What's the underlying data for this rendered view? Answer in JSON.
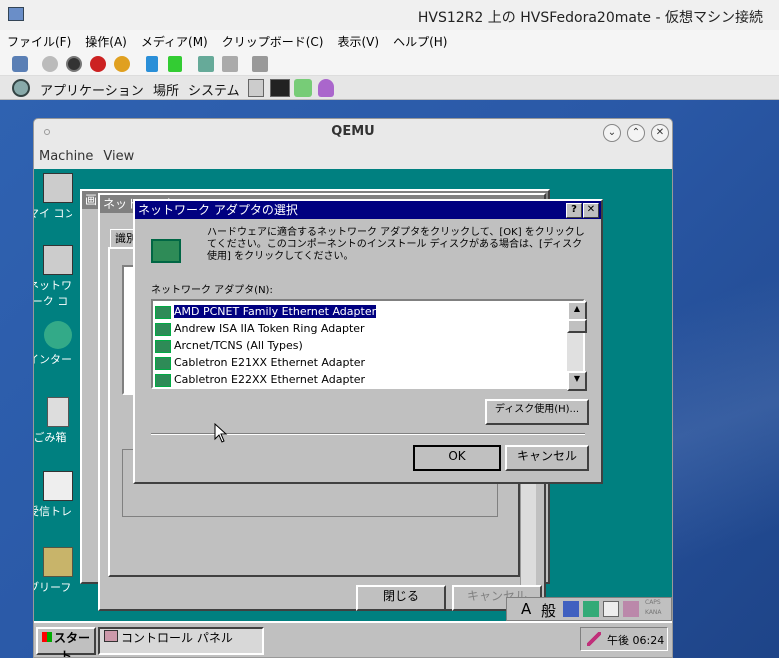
{
  "host": {
    "title": "HVS12R2 上の HVSFedora20mate - 仮想マシン接続",
    "menu": [
      "ファイル(F)",
      "操作(A)",
      "メディア(M)",
      "クリップボード(C)",
      "表示(V)",
      "ヘルプ(H)"
    ]
  },
  "gnome": {
    "menu": [
      "アプリケーション",
      "場所",
      "システム"
    ]
  },
  "qemu": {
    "title": "QEMU",
    "menu": [
      "Machine",
      "View"
    ],
    "buttons": [
      "⌄",
      "⌃",
      "✕"
    ]
  },
  "desktop_icons": [
    "マイ コンピュータ",
    "ネットワーク コンピュータ",
    "インターネット",
    "ごみ箱",
    "受信トレイ",
    "ブリーフケース"
  ],
  "bg_window": {
    "title": "ネットワーク",
    "title2": "画",
    "tab": "識別",
    "close_label": "閉じる",
    "cancel_label": "キャンセル"
  },
  "dialog": {
    "title": "ネットワーク アダプタの選択",
    "help_btn": "?",
    "close_btn": "✕",
    "instructions": "ハードウェアに適合するネットワーク アダプタをクリックして、[OK] をクリックしてください。このコンポーネントのインストール ディスクがある場合は、[ディスク使用] をクリックしてください。",
    "list_label": "ネットワーク アダプタ(N):",
    "adapters": [
      "AMD PCNET Family Ethernet Adapter",
      "Andrew ISA IIA Token Ring Adapter",
      "Arcnet/TCNS (All Types)",
      "Cabletron E21XX Ethernet Adapter",
      "Cabletron E22XX Ethernet Adapter"
    ],
    "disk_btn": "ディスク使用(H)...",
    "ok": "OK",
    "cancel": "キャンセル"
  },
  "taskbar": {
    "start": "スタート",
    "task": "コントロール パネル",
    "time": "午後 06:24"
  },
  "ime": {
    "a": "A",
    "mode": "般",
    "caps": "CAPS",
    "kana": "KANA"
  }
}
